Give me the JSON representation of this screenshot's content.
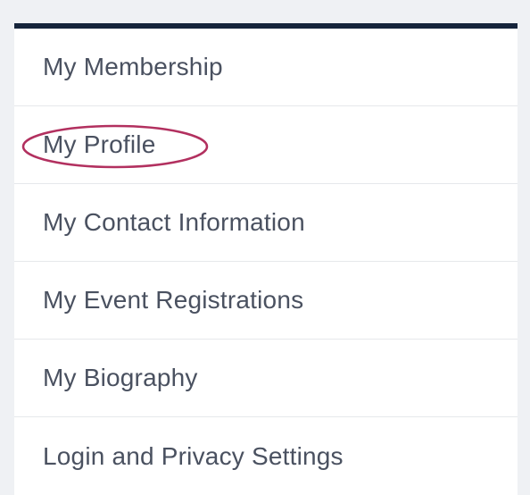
{
  "account_menu": {
    "items": [
      {
        "label": "My Membership",
        "highlighted": false
      },
      {
        "label": "My Profile",
        "highlighted": true
      },
      {
        "label": "My Contact Information",
        "highlighted": false
      },
      {
        "label": "My Event Registrations",
        "highlighted": false
      },
      {
        "label": "My Biography",
        "highlighted": false
      },
      {
        "label": "Login and Privacy Settings",
        "highlighted": false
      }
    ],
    "colors": {
      "top_border": "#16243b",
      "text": "#4a5160",
      "highlight_ellipse": "#b2305f",
      "background": "#eff1f4"
    }
  }
}
